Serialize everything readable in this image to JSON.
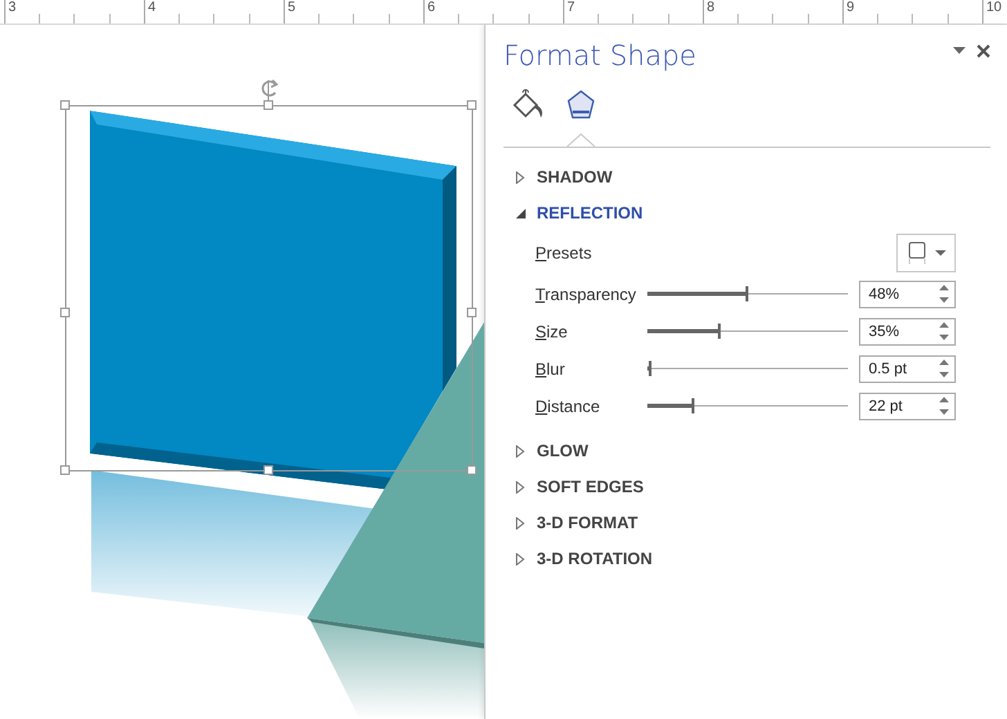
{
  "ruler": {
    "labels": [
      "3",
      "4",
      "5",
      "6",
      "7",
      "8",
      "9",
      "10"
    ]
  },
  "panel": {
    "title": "Format Shape",
    "tabs": [
      {
        "kind": "fill",
        "selected": false
      },
      {
        "kind": "effects",
        "selected": true
      }
    ],
    "sections": [
      {
        "label": "SHADOW",
        "expanded": false
      },
      {
        "label": "REFLECTION",
        "expanded": true,
        "presets_label": "Presets",
        "settings": [
          {
            "label": "Transparency",
            "level": 0.48,
            "value": "48%"
          },
          {
            "label": "Size",
            "level": 0.35,
            "value": "35%"
          },
          {
            "label": "Blur",
            "level": 0.005,
            "value": "0.5 pt"
          },
          {
            "label": "Distance",
            "level": 0.22,
            "value": "22 pt"
          }
        ]
      },
      {
        "label": "GLOW",
        "expanded": false
      },
      {
        "label": "SOFT EDGES",
        "expanded": false
      },
      {
        "label": "3-D FORMAT",
        "expanded": false
      },
      {
        "label": "3-D ROTATION",
        "expanded": false
      }
    ]
  }
}
